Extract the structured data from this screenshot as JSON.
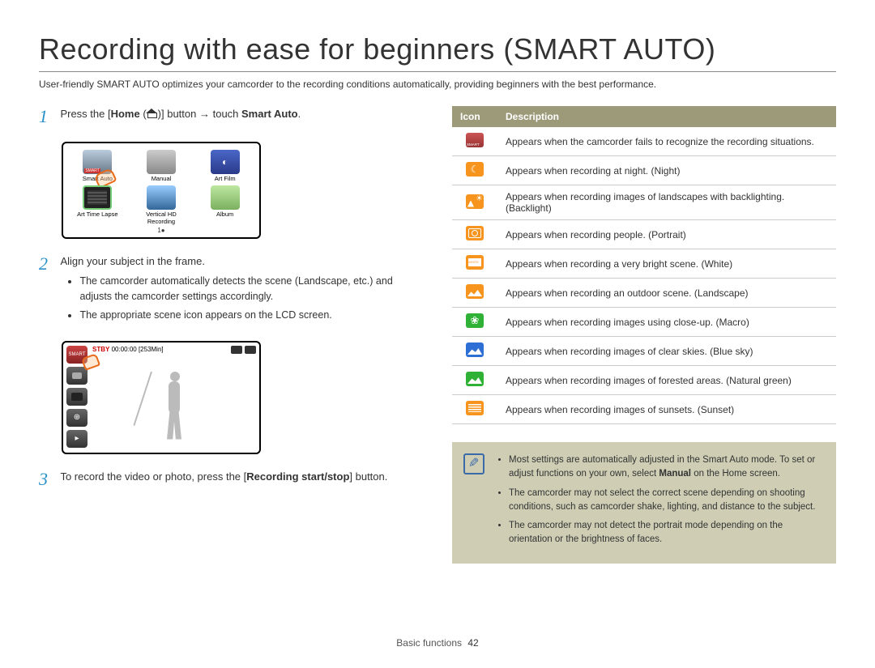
{
  "title": "Recording with ease for beginners (SMART AUTO)",
  "intro": "User-friendly SMART AUTO optimizes your camcorder to the recording conditions automatically, providing beginners with the best performance.",
  "steps": {
    "s1": {
      "num": "1",
      "pre": "Press the [",
      "home": "Home",
      "mid": " (",
      "post": ")] button ",
      "arrow": "→",
      "tail": " touch ",
      "smart": "Smart Auto",
      "end": "."
    },
    "s2": {
      "num": "2",
      "text": "Align your subject in the frame.",
      "b1": "The camcorder automatically detects the scene (Landscape, etc.) and adjusts the camcorder settings accordingly.",
      "b2": "The appropriate scene icon appears on the LCD screen."
    },
    "s3": {
      "num": "3",
      "pre": "To record the video or photo, press the [",
      "bold": "Recording start/stop",
      "post": "] button."
    }
  },
  "menu": {
    "smart": "Smart Auto",
    "manual": "Manual",
    "artfilm": "Art Film",
    "lapse": "Art Time Lapse",
    "vertical": "Vertical HD Recording",
    "album": "Album",
    "footer": "1●"
  },
  "lcd": {
    "stby": "STBY",
    "time": "00:00:00 [253Min]"
  },
  "table": {
    "h_icon": "Icon",
    "h_desc": "Description",
    "rows": [
      {
        "desc": "Appears when the camcorder fails to recognize the recording situations."
      },
      {
        "desc": "Appears when recording at night. (Night)"
      },
      {
        "desc": "Appears when recording images of landscapes with backlighting. (Backlight)"
      },
      {
        "desc": "Appears when recording people. (Portrait)"
      },
      {
        "desc": "Appears when recording a very bright scene. (White)"
      },
      {
        "desc": "Appears when recording an outdoor scene. (Landscape)"
      },
      {
        "desc": "Appears when recording images using close-up. (Macro)"
      },
      {
        "desc": "Appears when recording images of clear skies. (Blue sky)"
      },
      {
        "desc": "Appears when recording images of forested areas. (Natural green)"
      },
      {
        "desc": "Appears when recording images of sunsets. (Sunset)"
      }
    ]
  },
  "note": {
    "n1a": "Most settings are automatically adjusted in the Smart Auto mode. To set or adjust functions on your own, select ",
    "n1b": "Manual",
    "n1c": " on the Home screen.",
    "n2": "The camcorder may not select the correct scene depending on shooting conditions, such as camcorder shake, lighting, and distance to the subject.",
    "n3": "The camcorder may not detect the portrait mode depending on the orientation or the brightness of faces."
  },
  "footer": {
    "section": "Basic functions",
    "page": "42"
  }
}
